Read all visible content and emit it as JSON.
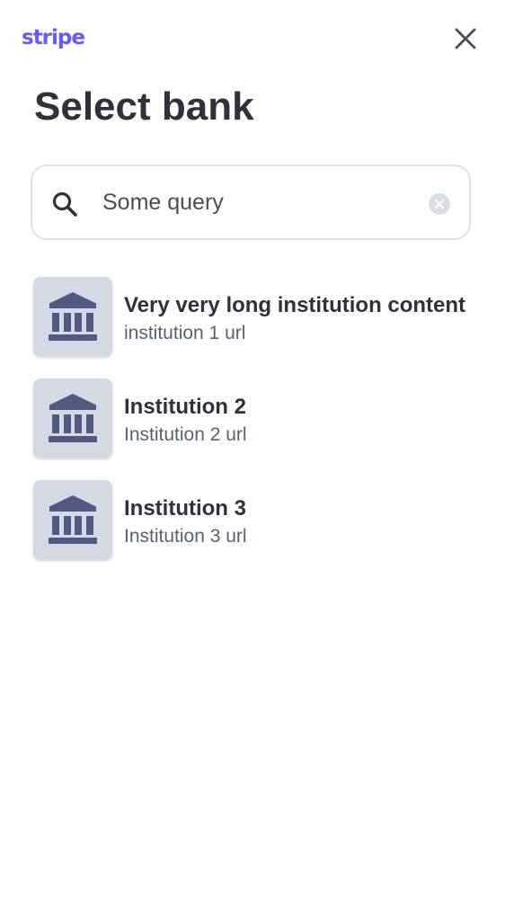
{
  "header": {
    "logo_text": "stripe",
    "close_icon": "close-icon",
    "title": "Select bank"
  },
  "search": {
    "icon": "search-icon",
    "value": "Some query",
    "clear_icon": "clear-circle-icon"
  },
  "institutions": [
    {
      "name": "Very very long institution content",
      "url": "institution 1 url",
      "icon": "bank-icon"
    },
    {
      "name": "Institution 2",
      "url": "Institution 2 url",
      "icon": "bank-icon"
    },
    {
      "name": "Institution 3",
      "url": "Institution 3 url",
      "icon": "bank-icon"
    }
  ],
  "colors": {
    "brand": "#635bff",
    "text": "#30313d",
    "muted": "#596171",
    "tile_bg": "#d4dae3",
    "bank_icon": "#4f5b82"
  }
}
